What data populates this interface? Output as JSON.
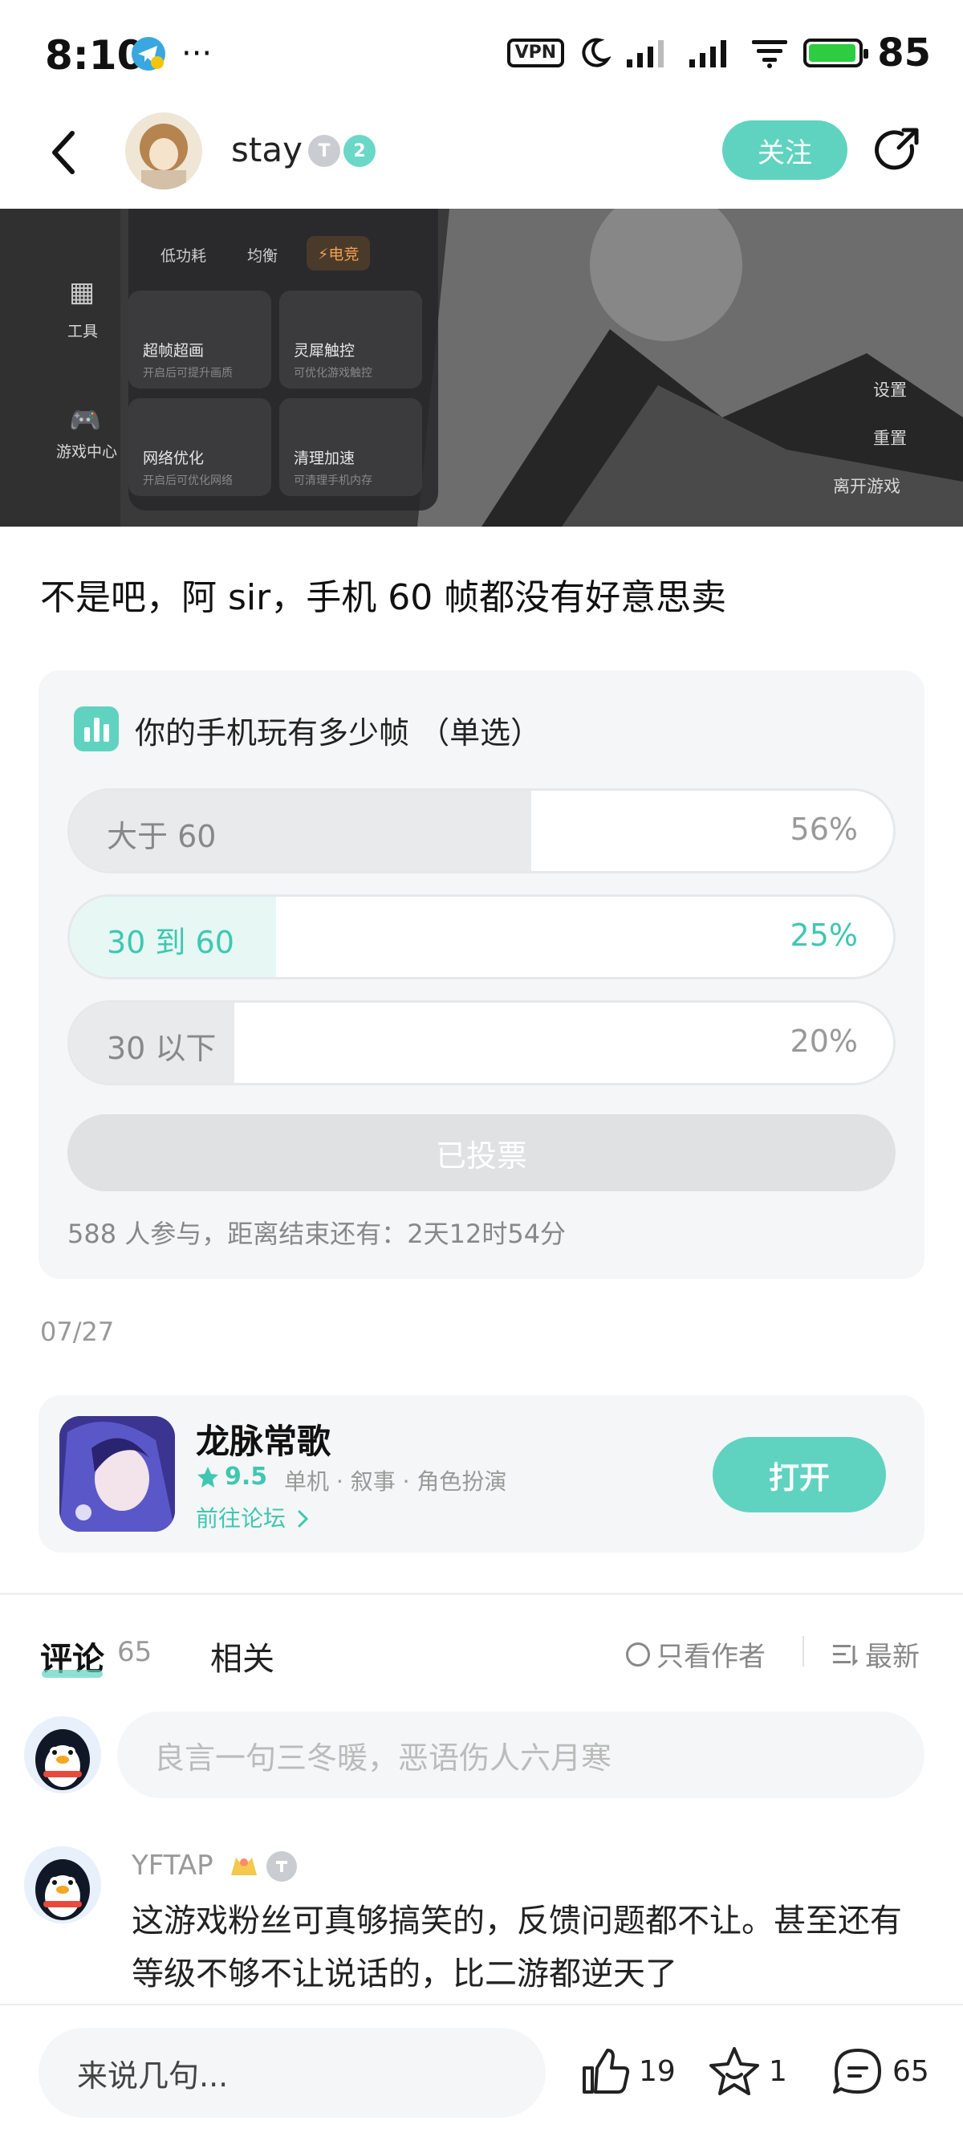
{
  "status_bar": {
    "time": "8:10",
    "more": "···",
    "vpn": "VPN",
    "battery": "85"
  },
  "header": {
    "username": "stay",
    "badge_t": "T",
    "badge_level": "2",
    "follow_label": "关注"
  },
  "hero": {
    "modes": [
      "低功耗",
      "均衡",
      "⚡电竞"
    ],
    "sidebar": [
      "工具",
      "游戏中心"
    ],
    "tiles": [
      {
        "title": "超帧超画",
        "sub": "开启后可提升画质"
      },
      {
        "title": "灵犀触控",
        "sub": "可优化游戏触控"
      },
      {
        "title": "网络优化",
        "sub": "开启后可优化网络"
      },
      {
        "title": "清理加速",
        "sub": "可清理手机内存"
      }
    ],
    "menu": [
      "设置",
      "重置",
      "离开游戏"
    ]
  },
  "post": {
    "title": "不是吧，阿 sir，手机 60 帧都没有好意思卖",
    "date": "07/27"
  },
  "poll": {
    "question": "你的手机玩有多少帧 （单选）",
    "options": [
      {
        "label": "大于 60",
        "percent": "56%",
        "share": 0.56,
        "selected": false
      },
      {
        "label": "30 到 60",
        "percent": "25%",
        "share": 0.25,
        "selected": true
      },
      {
        "label": "30 以下",
        "percent": "20%",
        "share": 0.2,
        "selected": false
      }
    ],
    "voted_label": "已投票",
    "meta": "588 人参与，距离结束还有：2天12时54分"
  },
  "game": {
    "name": "龙脉常歌",
    "rating": "9.5",
    "tags": "单机 · 叙事 · 角色扮演",
    "forum_link": "前往论坛",
    "open_label": "打开"
  },
  "tabs": {
    "comments_label": "评论",
    "comments_count": "65",
    "related_label": "相关",
    "author_only": "只看作者",
    "sort_label": "最新"
  },
  "comment_input": {
    "placeholder": "良言一句三冬暖，恶语伤人六月寒"
  },
  "comments": [
    {
      "user": "YFTAP",
      "text": "这游戏粉丝可真够搞笑的，反馈问题都不让。甚至还有等级不够不让说话的，比二游都逆天了"
    }
  ],
  "bottom_bar": {
    "input_placeholder": "来说几句...",
    "likes": "19",
    "favorites": "1",
    "comments": "65"
  },
  "colors": {
    "accent": "#5fd3c0",
    "accent_text": "#3fc7b1",
    "card_bg": "#f5f6f7"
  }
}
